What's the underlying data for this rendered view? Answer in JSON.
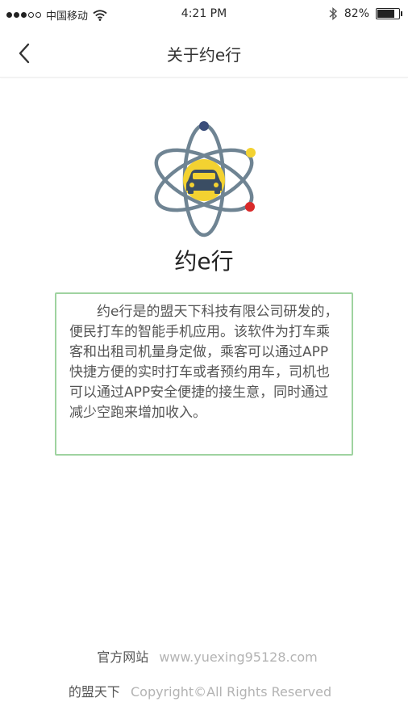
{
  "status_bar": {
    "carrier": "中国移动",
    "time": "4:21 PM",
    "battery_percent": "82%",
    "battery_level": 0.82,
    "signal_bars_filled": 3,
    "signal_bars_total": 5,
    "icons": [
      "wifi-icon",
      "bluetooth-icon",
      "battery-icon"
    ]
  },
  "nav": {
    "title": "关于约e行",
    "back_icon": "chevron-left-icon"
  },
  "app": {
    "name": "约e行",
    "logo_icon": "atom-car-icon",
    "colors": {
      "orbit": "#6f8493",
      "nucleus": "#f3d231",
      "car": "#3a4d63",
      "electron_top": "#3a4d7a",
      "electron_right": "#f3d231",
      "electron_bottom": "#d92a2a"
    }
  },
  "description": "约e行是的盟天下科技有限公司研发的，便民打车的智能手机应用。该软件为打车乘客和出租司机量身定做，乘客可以通过APP快捷方便的实时打车或者预约用车，司机也可以通过APP安全便捷的接生意，同时通过减少空跑来增加收入。",
  "footer": {
    "website_label": "官方网站",
    "website_url": "www.yuexing95128.com",
    "company": "的盟天下",
    "copyright": "Copyright©All Rights Reserved"
  },
  "accent_colors": {
    "box_border": "#9fd3a0",
    "footer_value": "#b3b3b3"
  }
}
